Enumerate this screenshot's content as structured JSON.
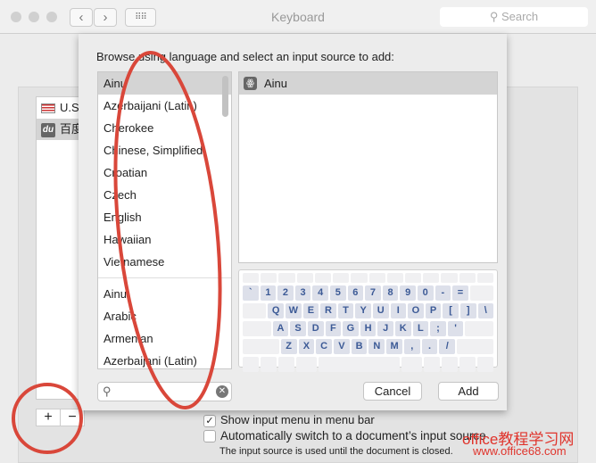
{
  "window": {
    "title": "Keyboard",
    "search_placeholder": "Search"
  },
  "sources": [
    {
      "label": "U.S.",
      "icon": "us-flag-icon"
    },
    {
      "label": "百度",
      "icon": "baidu-du-icon",
      "badge": "du"
    }
  ],
  "buttons": {
    "add_symbol": "+",
    "remove_symbol": "−"
  },
  "options": {
    "show_menu": "Show input menu in menu bar",
    "show_menu_checked": true,
    "auto_switch": "Automatically switch to a document’s input source",
    "auto_switch_checked": false,
    "auto_switch_note": "The input source is used until the document is closed."
  },
  "sheet": {
    "prompt": "Browse using language and select an input source to add:",
    "languages_top": [
      "Ainu",
      "Azerbaijani (Latin)",
      "Cherokee",
      "Chinese, Simplified",
      "Croatian",
      "Czech",
      "English",
      "Hawaiian",
      "Vietnamese"
    ],
    "languages_all": [
      "Ainu",
      "Arabic",
      "Armenian",
      "Azerbaijani (Latin)"
    ],
    "selected_language": "Ainu",
    "input_sources": [
      "Ainu"
    ],
    "keyboard_rows": [
      [
        "`",
        "1",
        "2",
        "3",
        "4",
        "5",
        "6",
        "7",
        "8",
        "9",
        "0",
        "-",
        "="
      ],
      [
        "Q",
        "W",
        "E",
        "R",
        "T",
        "Y",
        "U",
        "I",
        "O",
        "P",
        "[",
        "]",
        "\\"
      ],
      [
        "A",
        "S",
        "D",
        "F",
        "G",
        "H",
        "J",
        "K",
        "L",
        ";",
        "'"
      ],
      [
        "Z",
        "X",
        "C",
        "V",
        "B",
        "N",
        "M",
        ",",
        ".",
        "/"
      ]
    ],
    "search_value": "",
    "cancel": "Cancel",
    "add": "Add"
  },
  "watermark": {
    "line1": "office教程学习网",
    "line2": "www.office68.com"
  },
  "annotation_color": "#d9473a"
}
